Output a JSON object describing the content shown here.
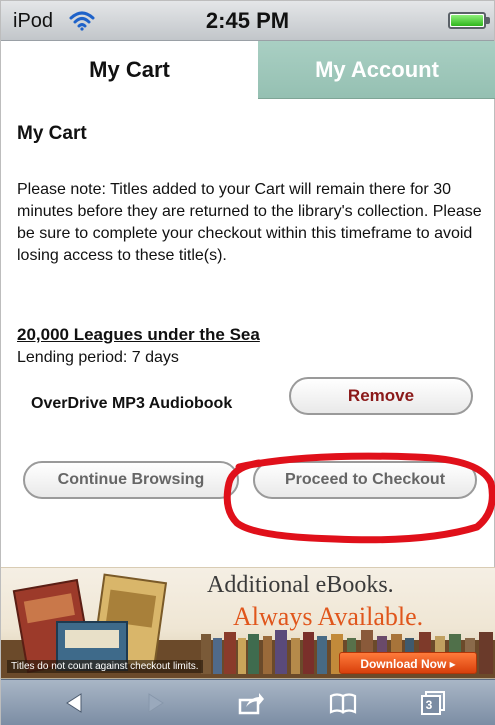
{
  "status_bar": {
    "carrier": "iPod",
    "time": "2:45 PM"
  },
  "tabs": [
    {
      "label": "My Cart",
      "active": true
    },
    {
      "label": "My Account",
      "active": false
    }
  ],
  "cart": {
    "title": "My Cart",
    "note": "Please note: Titles added to your Cart will remain there for 30 minutes before they are returned to the library's collection. Please be sure to complete your checkout within this timeframe to avoid losing access to these title(s).",
    "items": [
      {
        "title": "20,000 Leagues under the Sea",
        "lending_period": "Lending period: 7 days",
        "format": "OverDrive MP3 Audiobook",
        "remove_label": "Remove"
      }
    ],
    "continue_label": "Continue Browsing",
    "checkout_label": "Proceed to Checkout"
  },
  "banner": {
    "line1": "Additional eBooks.",
    "line2": "Always Available.",
    "disclaimer": "Titles do not count against checkout limits.",
    "button_label": "Download Now ▸"
  },
  "toolbar": {
    "tabs_count": "3"
  },
  "colors": {
    "tab_inactive": "#9fc7ba",
    "remove_text": "#8b1a1a",
    "highlight": "#e0101a",
    "banner_accent": "#e0561c",
    "toolbar": "#8fa0b5"
  }
}
